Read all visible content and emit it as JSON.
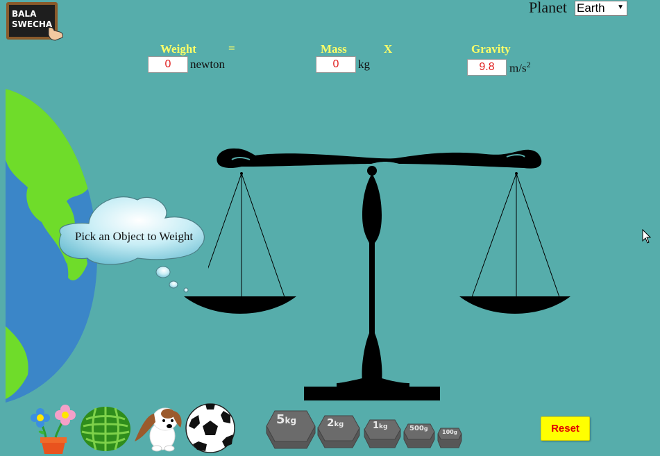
{
  "logo": {
    "line1": "BALA",
    "line2": "SWECHA"
  },
  "planet": {
    "label": "Planet",
    "selected": "Earth"
  },
  "formula": {
    "weight_label": "Weight",
    "equals": "=",
    "mass_label": "Mass",
    "times": "X",
    "gravity_label": "Gravity",
    "weight_value": "0",
    "weight_unit": "newton",
    "mass_value": "0",
    "mass_unit": "kg",
    "gravity_value": "9.8",
    "gravity_unit": "m/s",
    "gravity_unit_sup": "2"
  },
  "prompt": {
    "text": "Pick an Object to Weight"
  },
  "objects": [
    "flower-pot",
    "watermelon",
    "dog",
    "soccer-ball"
  ],
  "weights": [
    {
      "label": "5",
      "unit": "kg"
    },
    {
      "label": "2",
      "unit": "kg"
    },
    {
      "label": "1",
      "unit": "kg"
    },
    {
      "label": "500",
      "unit": "g"
    },
    {
      "label": "100",
      "unit": "g"
    }
  ],
  "reset_label": "Reset",
  "colors": {
    "background": "#56adab",
    "label": "#ffff66",
    "value": "#e02020",
    "reset_bg": "#ffff00"
  }
}
